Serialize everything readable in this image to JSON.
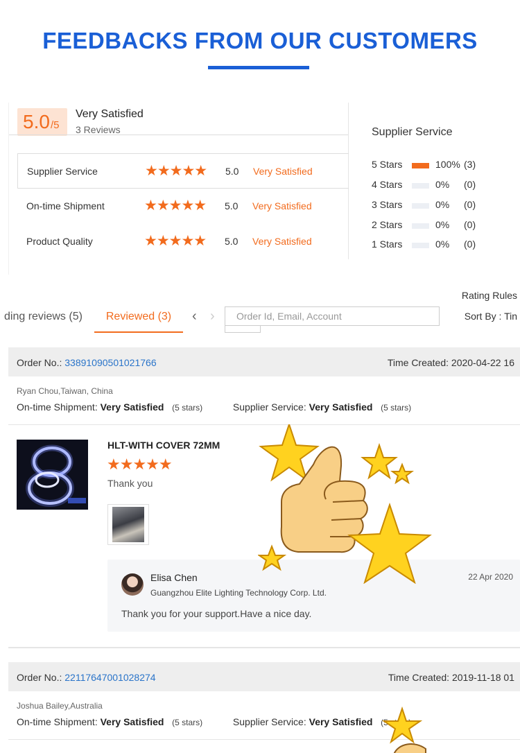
{
  "hero": {
    "title": "FEEDBACKS FROM OUR CUSTOMERS"
  },
  "overall": {
    "score": "5.0",
    "score_max": "/5",
    "label": "Very Satisfied",
    "reviews": "3 Reviews"
  },
  "ratings": [
    {
      "label": "Supplier Service",
      "stars": 5,
      "score": "5.0",
      "text": "Very Satisfied"
    },
    {
      "label": "On-time Shipment",
      "stars": 5,
      "score": "5.0",
      "text": "Very Satisfied"
    },
    {
      "label": "Product Quality",
      "stars": 5,
      "score": "5.0",
      "text": "Very Satisfied"
    }
  ],
  "supplier_service": {
    "title": "Supplier Service",
    "distribution": [
      {
        "label": "5 Stars",
        "fraction": 1.0,
        "pct": "100%",
        "count": "(3)"
      },
      {
        "label": "4 Stars",
        "fraction": 0,
        "pct": "0%",
        "count": "(0)"
      },
      {
        "label": "3 Stars",
        "fraction": 0,
        "pct": "0%",
        "count": "(0)"
      },
      {
        "label": "2 Stars",
        "fraction": 0,
        "pct": "0%",
        "count": "(0)"
      },
      {
        "label": "1 Stars",
        "fraction": 0,
        "pct": "0%",
        "count": "(0)"
      }
    ]
  },
  "tabs": {
    "pending": "ding reviews (5)",
    "reviewed": "Reviewed (3)",
    "rating_rules": "Rating Rules",
    "search_placeholder": "Order Id, Email, Account",
    "sort_by": "Sort By : Tin"
  },
  "orders": [
    {
      "order_label": "Order No.:",
      "order_no": "33891090501021766",
      "time_created": "Time Created: 2020-04-22 16",
      "buyer": "Ryan Chou,Taiwan, China",
      "shipment_label": "On-time Shipment:",
      "shipment_value": "Very Satisfied",
      "shipment_stars": "(5 stars)",
      "service_label": "Supplier Service:",
      "service_value": "Very Satisfied",
      "service_stars": "(5 stars)",
      "product_name": "HLT-WITH COVER 72MM",
      "product_stars": "★★★★★",
      "comment": "Thank you",
      "reply": {
        "name": "Elisa Chen",
        "company": "Guangzhou Elite Lighting Technology Corp. Ltd.",
        "date": "22 Apr 2020",
        "text": "Thank you for your support.Have a nice day."
      }
    },
    {
      "order_label": "Order No.:",
      "order_no": "22117647001028274",
      "time_created": "Time Created: 2019-11-18 01",
      "buyer": "Joshua Bailey,Australia",
      "shipment_label": "On-time Shipment:",
      "shipment_value": "Very Satisfied",
      "shipment_stars": "(5 stars)",
      "service_label": "Supplier Service:",
      "service_value": "Very Satisfied",
      "service_stars": "(5 stars)"
    }
  ],
  "icons": {
    "star": "★",
    "arrow_left": "‹",
    "arrow_right": "›"
  },
  "colors": {
    "brand_blue": "#1a5fd6",
    "accent_orange": "#f26b1d",
    "link_blue": "#2a74c9"
  }
}
